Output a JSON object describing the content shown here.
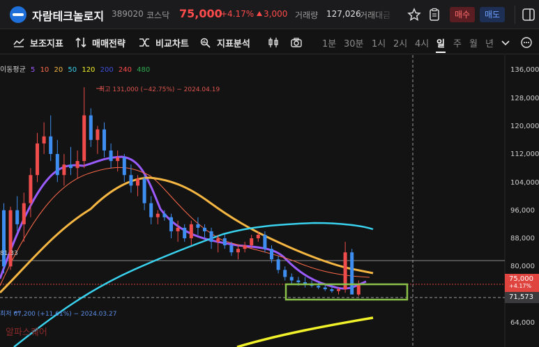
{
  "header": {
    "name": "자람테크놀로지",
    "code": "389020",
    "market": "코스닥",
    "price": "75,000",
    "change_pct": "+4.17%",
    "change_amt": "3,000",
    "volume_label": "거래량",
    "volume": "127,026",
    "amount_label": "거래대금",
    "buy_label": "매수",
    "sell_label": "매도",
    "icons": [
      "star-icon",
      "clipboard-icon",
      "panel-icon"
    ]
  },
  "toolbar": {
    "tools": [
      {
        "label": "보조지표",
        "icon": "indicator-icon"
      },
      {
        "label": "매매전략",
        "icon": "strategy-icon"
      },
      {
        "label": "비교차트",
        "icon": "compare-icon"
      },
      {
        "label": "지표분석",
        "icon": "analysis-icon"
      }
    ],
    "extra_icons": [
      "candle-icon",
      "camera-icon"
    ],
    "timeframes": [
      "1분",
      "30분",
      "1시",
      "2시",
      "4시",
      "일",
      "주",
      "월",
      "년"
    ],
    "active_timeframe": "일"
  },
  "chart": {
    "ma_label": "이동평균",
    "ma_periods": [
      {
        "label": "5",
        "color": "#9b5cff"
      },
      {
        "label": "10",
        "color": "#ff6b4a"
      },
      {
        "label": "20",
        "color": "#f5b642"
      },
      {
        "label": "50",
        "color": "#39d3f0"
      },
      {
        "label": "120",
        "color": "#f2f22a"
      },
      {
        "label": "200",
        "color": "#3e4fd8"
      },
      {
        "label": "240",
        "color": "#ff4b4b"
      },
      {
        "label": "480",
        "color": "#2fa84f"
      }
    ],
    "high_note": "최고 131,000 (−42.75%) − 2024.04.19",
    "low_note": "최저 67,200 (+11.61%) − 2024.03.27",
    "left_value": "81.33",
    "y_ticks": [
      "136,000",
      "128,000",
      "120,000",
      "112,000",
      "104,000",
      "96,000",
      "88,000",
      "80,000",
      "72,000",
      "64,000"
    ],
    "price_label": "75,000",
    "price_sub": "+4.17%",
    "crosshair_label": "71,573",
    "watermark": "알파스퀘어",
    "colors": {
      "up": "#f04c4c",
      "down": "#3d8ef0",
      "box": "#8bc34a"
    }
  },
  "chart_data": {
    "type": "candlestick",
    "ylim": [
      62000,
      138000
    ],
    "candles": [
      [
        96000,
        98000,
        78000,
        80000
      ],
      [
        80000,
        97000,
        79000,
        96000
      ],
      [
        96000,
        100000,
        90000,
        92000
      ],
      [
        92000,
        101000,
        87000,
        98000
      ],
      [
        98000,
        108000,
        94000,
        106000
      ],
      [
        106000,
        118000,
        104000,
        115000
      ],
      [
        115000,
        121000,
        112000,
        117000
      ],
      [
        117000,
        123000,
        110000,
        112000
      ],
      [
        112000,
        116000,
        104000,
        106000
      ],
      [
        106000,
        112000,
        103000,
        109000
      ],
      [
        109000,
        114000,
        106000,
        108000
      ],
      [
        108000,
        113000,
        105000,
        110000
      ],
      [
        110000,
        131000,
        108000,
        123000
      ],
      [
        123000,
        125000,
        114000,
        116000
      ],
      [
        116000,
        120000,
        112000,
        119000
      ],
      [
        119000,
        121000,
        111000,
        113000
      ],
      [
        113000,
        115000,
        108000,
        110000
      ],
      [
        110000,
        113000,
        107000,
        111000
      ],
      [
        111000,
        112000,
        104000,
        106000
      ],
      [
        106000,
        109000,
        101000,
        103000
      ],
      [
        103000,
        106000,
        100000,
        105000
      ],
      [
        105000,
        106000,
        96000,
        98000
      ],
      [
        98000,
        100000,
        92000,
        94000
      ],
      [
        94000,
        96000,
        92000,
        95000
      ],
      [
        95000,
        96000,
        93000,
        94000
      ],
      [
        94000,
        95000,
        88000,
        90000
      ],
      [
        90000,
        93000,
        87000,
        91000
      ],
      [
        91000,
        92000,
        87000,
        88000
      ],
      [
        88000,
        93000,
        86000,
        92000
      ],
      [
        92000,
        94000,
        89000,
        91000
      ],
      [
        91000,
        92000,
        88000,
        90000
      ],
      [
        90000,
        91000,
        85000,
        87000
      ],
      [
        87000,
        89000,
        84000,
        88000
      ],
      [
        88000,
        89000,
        85000,
        86000
      ],
      [
        86000,
        87000,
        83000,
        84000
      ],
      [
        84000,
        86000,
        82000,
        85000
      ],
      [
        85000,
        87000,
        84000,
        86000
      ],
      [
        86000,
        89000,
        85000,
        88000
      ],
      [
        88000,
        90000,
        87000,
        89000
      ],
      [
        89000,
        90000,
        84000,
        85000
      ],
      [
        85000,
        86000,
        81000,
        82000
      ],
      [
        82000,
        83000,
        78000,
        79000
      ],
      [
        79000,
        80000,
        76000,
        77000
      ],
      [
        77000,
        78000,
        75000,
        76000
      ],
      [
        76000,
        77000,
        74500,
        75500
      ],
      [
        75500,
        77000,
        74000,
        75000
      ],
      [
        75000,
        76000,
        74000,
        74500
      ],
      [
        74500,
        75500,
        73500,
        74000
      ],
      [
        74000,
        75000,
        73000,
        73500
      ],
      [
        73500,
        74500,
        72500,
        73000
      ],
      [
        73000,
        74000,
        72000,
        73500
      ],
      [
        73500,
        87000,
        72500,
        84000
      ],
      [
        84000,
        85000,
        72000,
        72000
      ],
      [
        72000,
        76000,
        71500,
        75000
      ]
    ]
  }
}
